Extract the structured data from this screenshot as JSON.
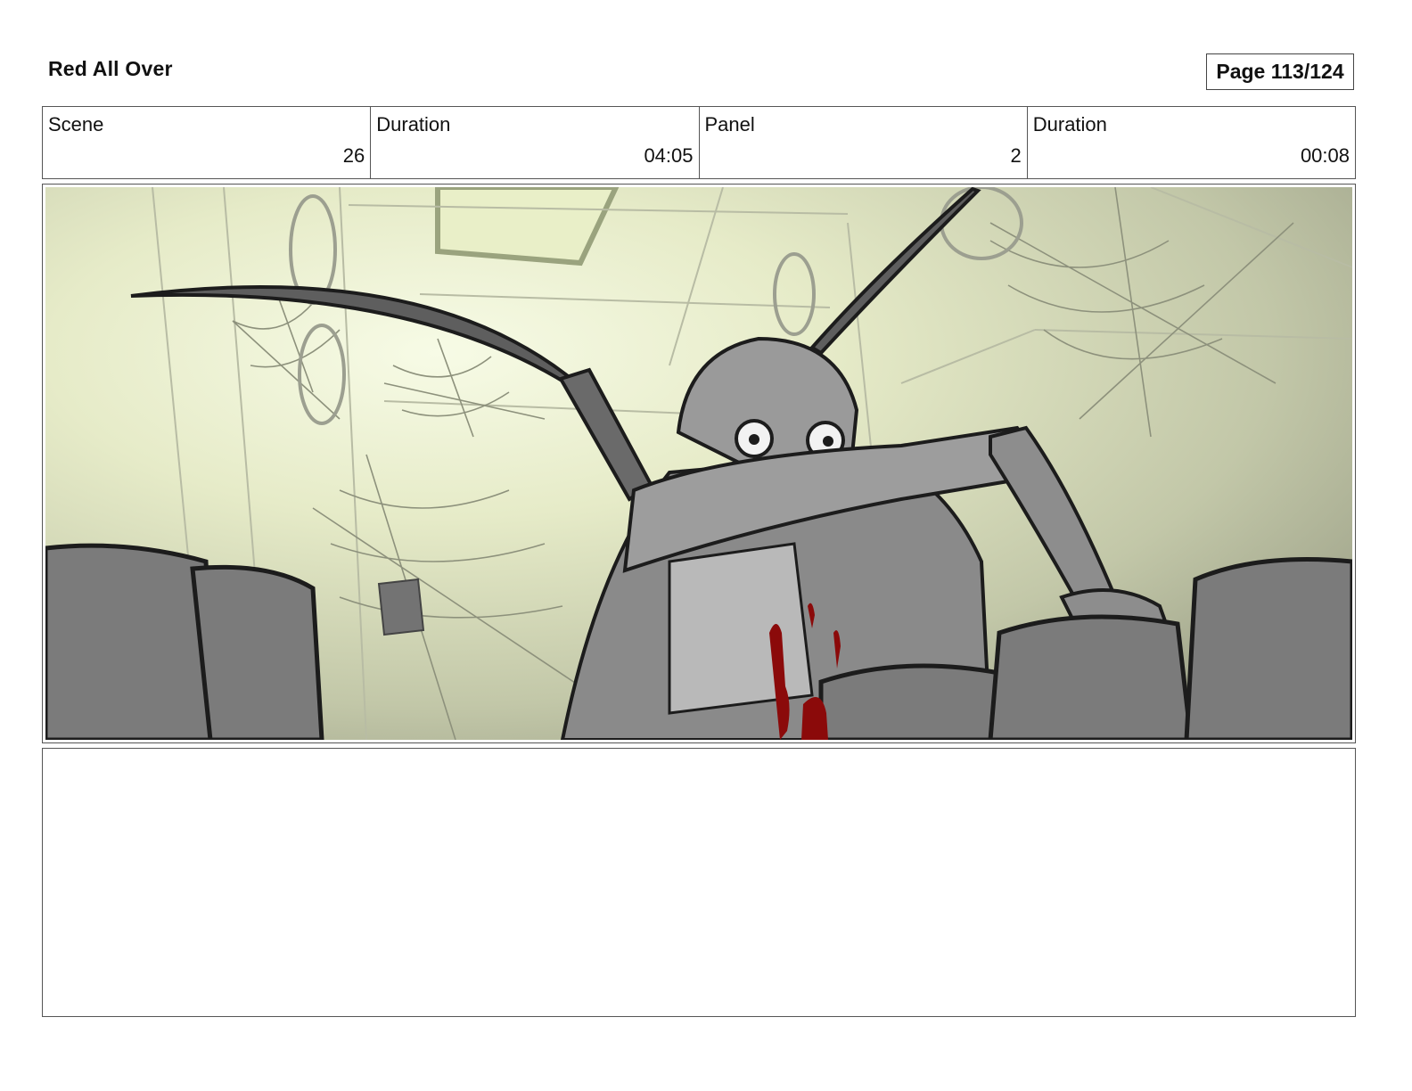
{
  "header": {
    "title": "Red All Over",
    "page": "Page 113/124"
  },
  "info": [
    {
      "label": "Scene",
      "value": "26"
    },
    {
      "label": "Duration",
      "value": "04:05"
    },
    {
      "label": "Panel",
      "value": "2"
    },
    {
      "label": "Duration",
      "value": "00:08"
    }
  ],
  "notes": {
    "text": ""
  },
  "colors": {
    "background_light": "#f4f8df",
    "background_shadow": "#a3a78f",
    "figure_gray": "#8c8c8c",
    "seat_gray": "#7a7a7a",
    "blood_red": "#8b0a0a"
  }
}
